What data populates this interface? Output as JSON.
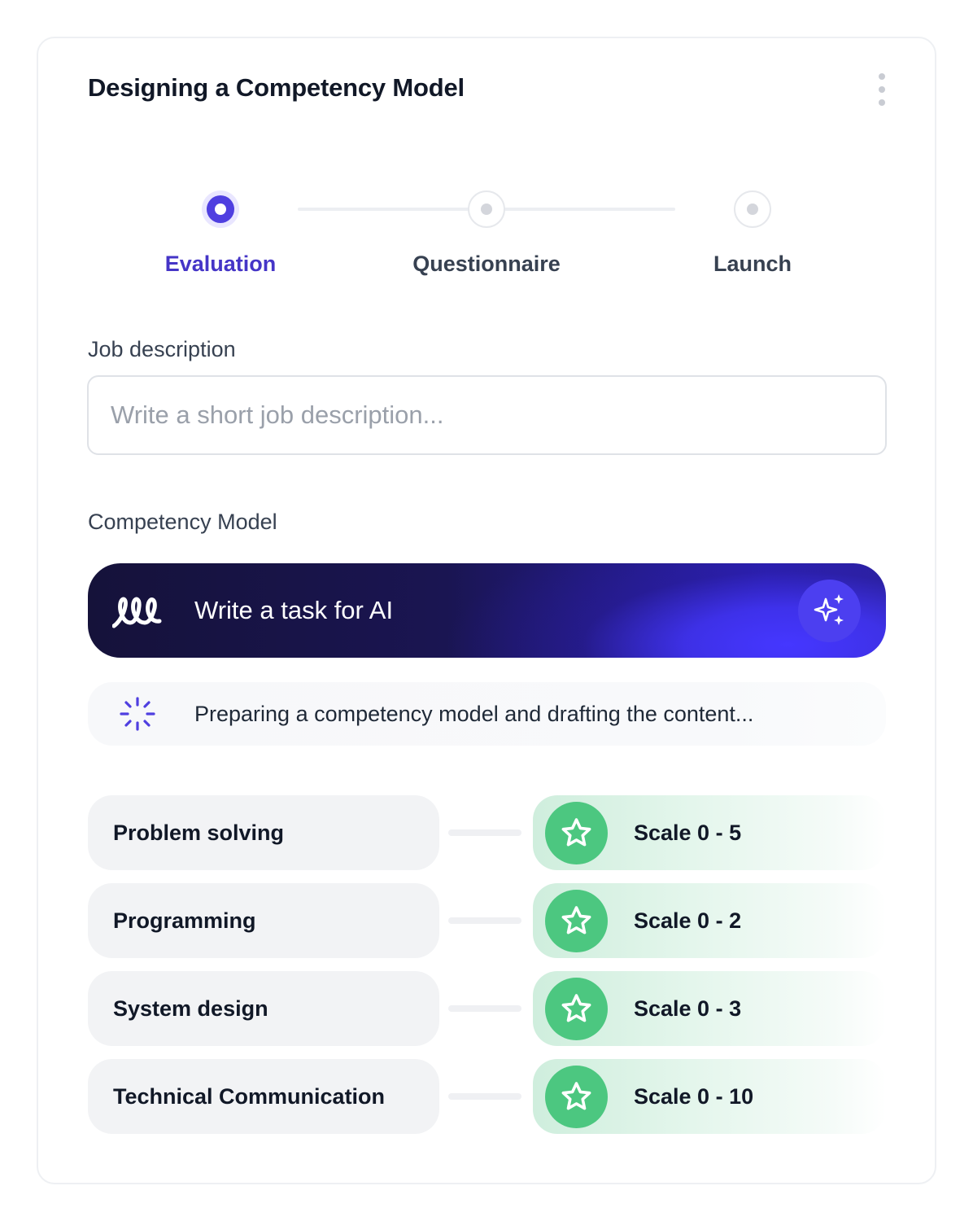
{
  "header": {
    "title": "Designing a Competency Model",
    "menu_icon": "more-vertical-icon"
  },
  "stepper": {
    "steps": [
      {
        "label": "Evaluation",
        "state": "active"
      },
      {
        "label": "Questionnaire",
        "state": "inactive"
      },
      {
        "label": "Launch",
        "state": "inactive"
      }
    ]
  },
  "job_description": {
    "label": "Job description",
    "value": "",
    "placeholder": "Write a short job description..."
  },
  "competency_model": {
    "label": "Competency Model",
    "ai_prompt": {
      "text": "Write a task for AI",
      "logo_icon": "ai-logo-icon",
      "button_icon": "sparkles-icon"
    },
    "status": {
      "text": "Preparing a competency model and drafting the content...",
      "icon": "loading-spinner-icon"
    },
    "items": [
      {
        "name": "Problem solving",
        "scale": "Scale 0 - 5"
      },
      {
        "name": "Programming",
        "scale": "Scale 0 - 2"
      },
      {
        "name": "System design",
        "scale": "Scale 0 - 3"
      },
      {
        "name": "Technical Communication",
        "scale": "Scale 0 - 10"
      }
    ]
  },
  "colors": {
    "accent": "#4f3fe0",
    "active_step_text": "#4535c7",
    "ai_bar_dark": "#15123a",
    "ai_button": "#4c3ff0",
    "star_badge": "#4cc780"
  }
}
